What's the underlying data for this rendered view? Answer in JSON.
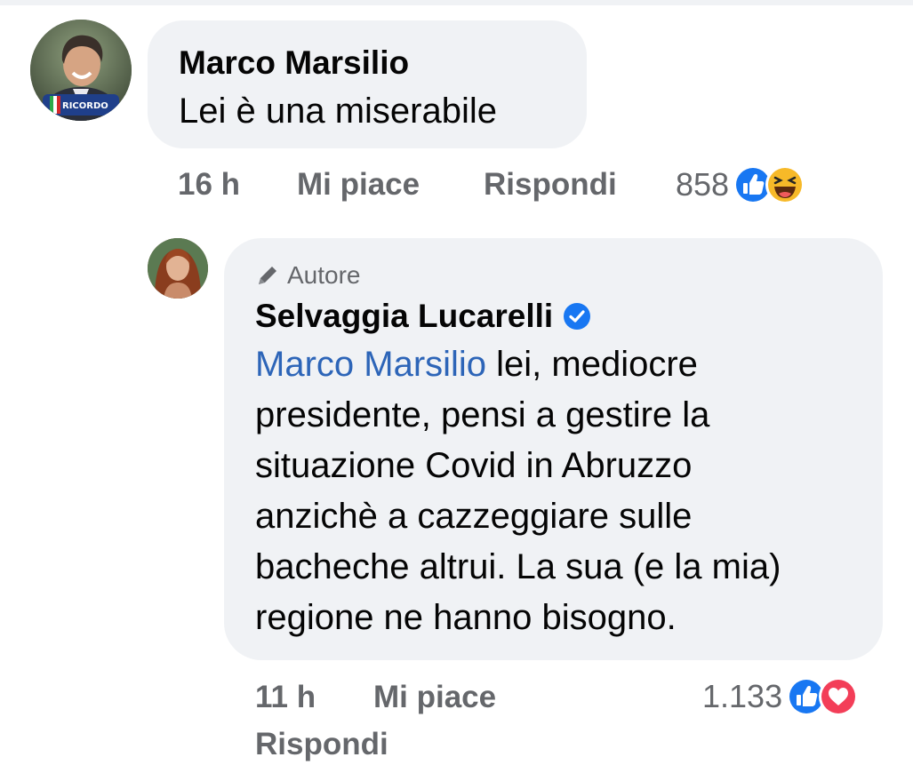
{
  "comment_1": {
    "author": "Marco Marsilio",
    "text": "Lei è una miserabile",
    "avatar_badge": "IO RICORDO",
    "time": "16 h",
    "like_label": "Mi piace",
    "reply_label": "Rispondi",
    "reaction_count": "858",
    "reaction_icons": [
      "like-icon",
      "haha-icon"
    ]
  },
  "comment_2": {
    "badge": "Autore",
    "author": "Selvaggia Lucarelli",
    "verified": true,
    "mention": "Marco Marsilio",
    "text_lines": [
      " lei, mediocre",
      "presidente, pensi a gestire la",
      "situazione Covid in Abruzzo",
      "anzichè a cazzeggiare sulle",
      "bacheche altrui. La sua (e la mia)",
      "regione ne hanno bisogno."
    ],
    "time": "11 h",
    "like_label": "Mi piace",
    "reply_label": "Rispondi",
    "reaction_count": "1.133",
    "reaction_icons": [
      "like-icon",
      "love-icon"
    ]
  },
  "colors": {
    "bubble_bg": "#f0f2f5",
    "text": "#050505",
    "meta": "#65676b",
    "mention": "#2d65b8",
    "facebook_blue": "#1877f2",
    "love_red": "#f33e58",
    "haha_yellow": "#f7b928"
  }
}
